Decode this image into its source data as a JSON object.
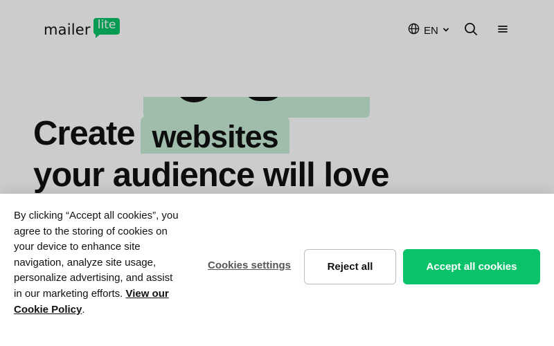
{
  "header": {
    "logo_word": "mailer",
    "logo_badge": "lite",
    "language": "EN"
  },
  "hero": {
    "line1_prefix": "Create",
    "line1_highlight": "websites",
    "line2": "your audience will love"
  },
  "cookie_banner": {
    "text": "By clicking “Accept all cookies”, you agree to the storing of cookies on your device to enhance site navigation, analyze site usage, personalize advertising, and assist in our marketing efforts.",
    "policy_link": "View our Cookie Policy",
    "trailing": ".",
    "settings_label": "Cookies settings",
    "reject_label": "Reject all",
    "accept_label": "Accept all cookies"
  },
  "colors": {
    "brand_green": "#09c269",
    "highlight_green": "#c8ecd6"
  }
}
